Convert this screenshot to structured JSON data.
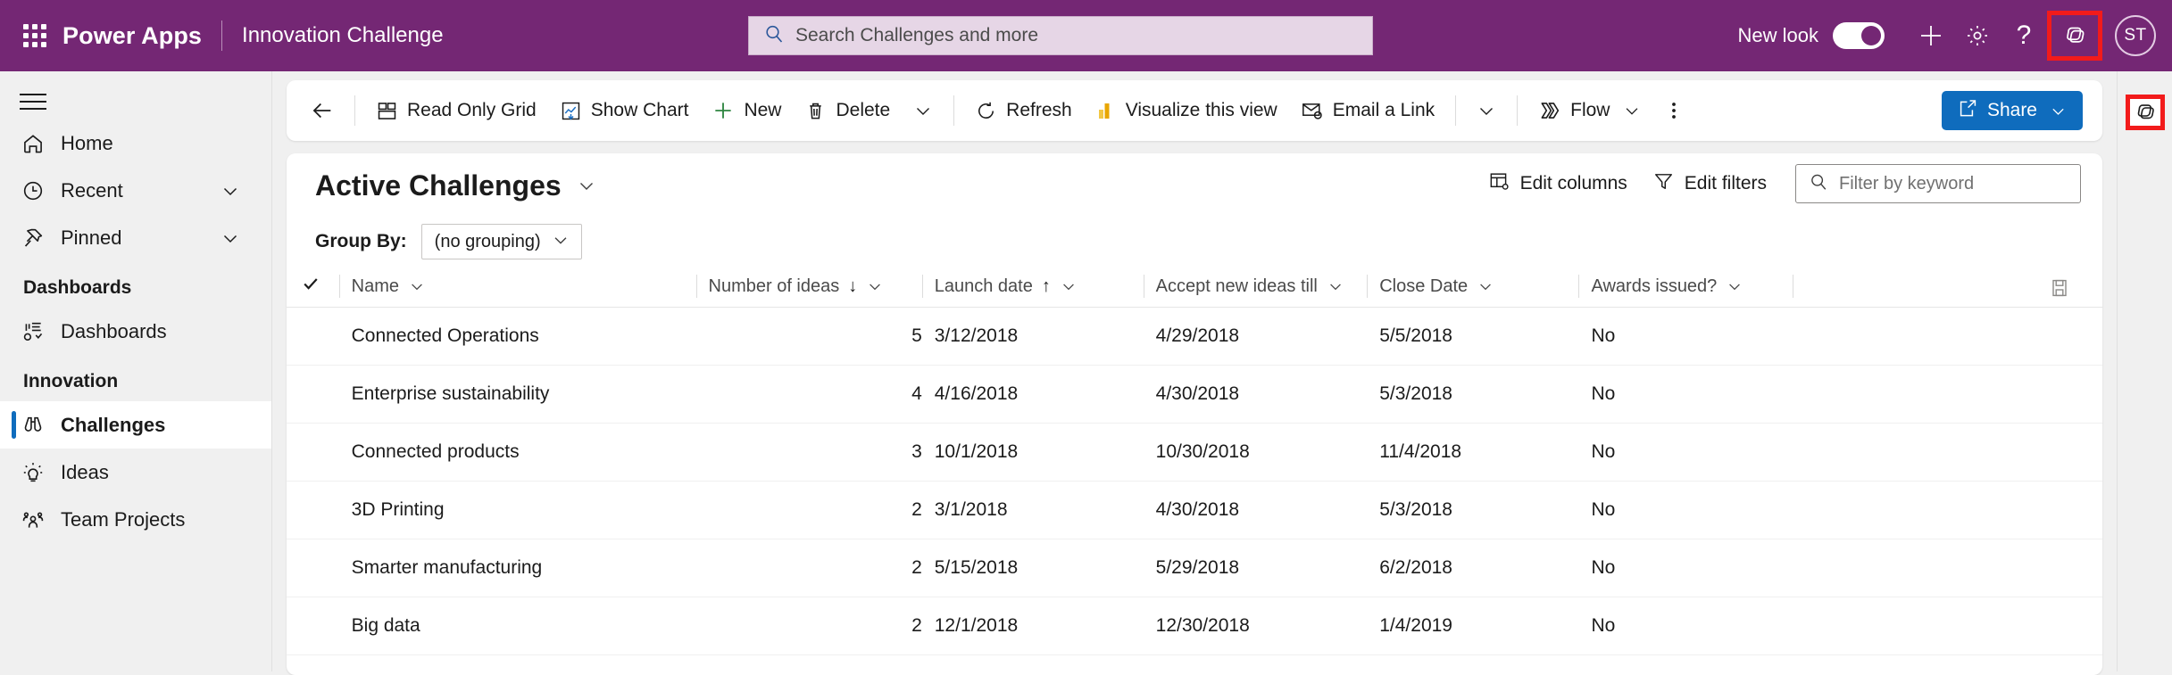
{
  "colors": {
    "brand_purple": "#742774",
    "accent_blue": "#0f6cbd",
    "highlight_red": "#f21b1b",
    "search_bg": "#e6d6e6"
  },
  "topbar": {
    "waffle_icon": "app-launcher-icon",
    "brand": "Power Apps",
    "app_name": "Innovation Challenge",
    "search": {
      "icon": "search-icon",
      "placeholder": "Search Challenges and more",
      "value": ""
    },
    "new_look_label": "New look",
    "new_look_on": true,
    "icons": [
      {
        "name": "plus-icon",
        "glyph": "+"
      },
      {
        "name": "gear-icon",
        "glyph": "settings"
      },
      {
        "name": "help-icon",
        "glyph": "?"
      },
      {
        "name": "copilot-icon",
        "glyph": "copilot",
        "highlighted": true
      }
    ],
    "avatar_initials": "ST"
  },
  "sidebar": {
    "hamburger_icon": "hamburger-menu-icon",
    "items": [
      {
        "label": "Home",
        "icon": "home-icon",
        "chevron": false,
        "selected": false
      },
      {
        "label": "Recent",
        "icon": "clock-icon",
        "chevron": true,
        "selected": false
      },
      {
        "label": "Pinned",
        "icon": "pin-icon",
        "chevron": true,
        "selected": false
      }
    ],
    "groups": [
      {
        "title": "Dashboards",
        "items": [
          {
            "label": "Dashboards",
            "icon": "dashboard-icon",
            "selected": false
          }
        ]
      },
      {
        "title": "Innovation",
        "items": [
          {
            "label": "Challenges",
            "icon": "binoculars-icon",
            "selected": true
          },
          {
            "label": "Ideas",
            "icon": "lightbulb-icon",
            "selected": false
          },
          {
            "label": "Team Projects",
            "icon": "people-icon",
            "selected": false
          }
        ]
      }
    ]
  },
  "command_bar": {
    "back_icon": "back-arrow-icon",
    "commands": [
      {
        "label": "Read Only Grid",
        "icon": "grid-icon"
      },
      {
        "label": "Show Chart",
        "icon": "chart-icon"
      },
      {
        "label": "New",
        "icon": "plus-icon"
      },
      {
        "label": "Delete",
        "icon": "trash-icon"
      }
    ],
    "overflow_chevron_1": "chevron-down-icon",
    "commands2": [
      {
        "label": "Refresh",
        "icon": "refresh-icon"
      },
      {
        "label": "Visualize this view",
        "icon": "powerbi-icon"
      },
      {
        "label": "Email a Link",
        "icon": "email-icon"
      }
    ],
    "overflow_chevron_2": "chevron-down-icon",
    "flow": {
      "label": "Flow",
      "icon": "flow-icon",
      "chevron": "chevron-down-icon"
    },
    "more_icon": "more-vertical-icon",
    "share": {
      "label": "Share",
      "icon": "share-icon",
      "chevron": "chevron-down-icon"
    }
  },
  "right_rail": {
    "copilot_icon": "copilot-icon",
    "highlighted": true
  },
  "view": {
    "title": "Active Challenges",
    "title_chevron": "chevron-down-icon",
    "edit_columns": {
      "label": "Edit columns",
      "icon": "edit-columns-icon"
    },
    "edit_filters": {
      "label": "Edit filters",
      "icon": "filter-icon"
    },
    "keyword_filter": {
      "placeholder": "Filter by keyword",
      "icon": "search-icon",
      "value": ""
    },
    "group_by_label": "Group By:",
    "group_by_value": "(no grouping)",
    "group_by_chevron": "chevron-down-icon",
    "save_columns_icon": "save-icon"
  },
  "table": {
    "select_all_icon": "checkmark-icon",
    "columns": [
      {
        "label": "Name",
        "sort": "",
        "chevron": "chevron-down-icon"
      },
      {
        "label": "Number of ideas",
        "sort": "↓",
        "chevron": "chevron-down-icon"
      },
      {
        "label": "Launch date",
        "sort": "↑",
        "chevron": "chevron-down-icon"
      },
      {
        "label": "Accept new ideas till",
        "sort": "",
        "chevron": "chevron-down-icon"
      },
      {
        "label": "Close Date",
        "sort": "",
        "chevron": "chevron-down-icon"
      },
      {
        "label": "Awards issued?",
        "sort": "",
        "chevron": "chevron-down-icon"
      }
    ],
    "rows": [
      {
        "name": "Connected Operations",
        "ideas": "5",
        "launch": "3/12/2018",
        "accept": "4/29/2018",
        "close": "5/5/2018",
        "awards": "No"
      },
      {
        "name": "Enterprise sustainability",
        "ideas": "4",
        "launch": "4/16/2018",
        "accept": "4/30/2018",
        "close": "5/3/2018",
        "awards": "No"
      },
      {
        "name": "Connected products",
        "ideas": "3",
        "launch": "10/1/2018",
        "accept": "10/30/2018",
        "close": "11/4/2018",
        "awards": "No"
      },
      {
        "name": "3D Printing",
        "ideas": "2",
        "launch": "3/1/2018",
        "accept": "4/30/2018",
        "close": "5/3/2018",
        "awards": "No"
      },
      {
        "name": "Smarter manufacturing",
        "ideas": "2",
        "launch": "5/15/2018",
        "accept": "5/29/2018",
        "close": "6/2/2018",
        "awards": "No"
      },
      {
        "name": "Big data",
        "ideas": "2",
        "launch": "12/1/2018",
        "accept": "12/30/2018",
        "close": "1/4/2019",
        "awards": "No"
      }
    ]
  }
}
